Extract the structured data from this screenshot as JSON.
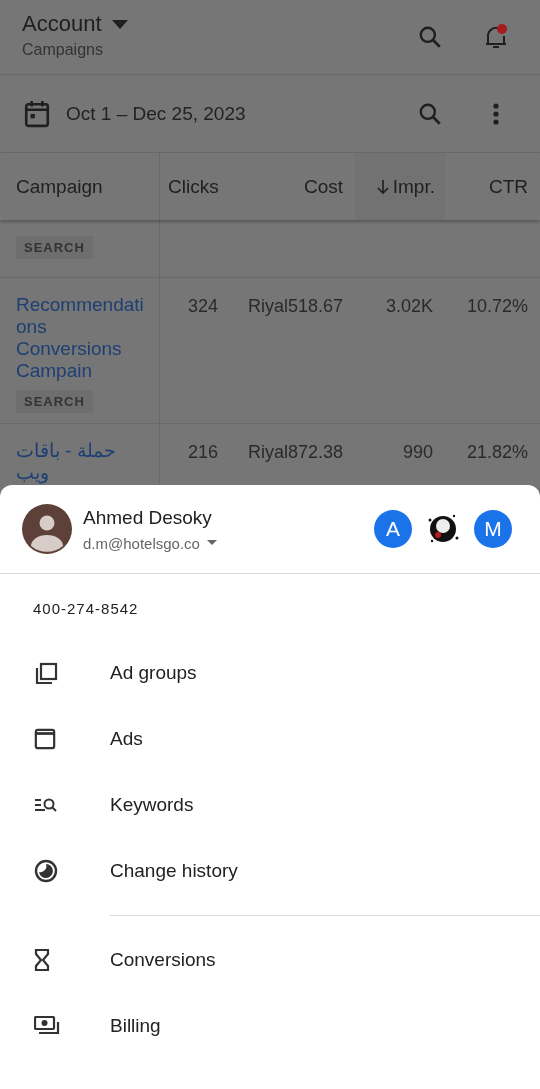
{
  "app_bar": {
    "title": "Account",
    "subtitle": "Campaigns",
    "unread_notifications": true
  },
  "date_range": "Oct 1 – Dec 25, 2023",
  "table": {
    "columns": [
      {
        "label": "Campaign",
        "sorted": false
      },
      {
        "label": "Clicks",
        "sorted": false
      },
      {
        "label": "Cost",
        "sorted": false
      },
      {
        "label": "Impr.",
        "sorted": true
      },
      {
        "label": "CTR",
        "sorted": false
      }
    ],
    "rows": [
      {
        "tag": "SEARCH",
        "values": []
      },
      {
        "campaign": "Recommendations Conversions Campain",
        "tag": "SEARCH",
        "values": [
          "324",
          "Riyal518.67",
          "3.02K",
          "10.72%"
        ]
      },
      {
        "campaign": "حملة - باقات ويب",
        "values": [
          "216",
          "Riyal872.38",
          "990",
          "21.82%"
        ]
      }
    ]
  },
  "account_sheet": {
    "name": "Ahmed Desoky",
    "email": "d.m@hotelsgo.co",
    "accounts": [
      {
        "kind": "letter",
        "label": "A"
      },
      {
        "kind": "picture"
      },
      {
        "kind": "letter",
        "label": "M"
      }
    ],
    "customer_id": "400-274-8542",
    "menu_sections": [
      [
        "Ad groups",
        "Ads",
        "Keywords",
        "Change history"
      ],
      [
        "Conversions",
        "Billing"
      ]
    ]
  }
}
